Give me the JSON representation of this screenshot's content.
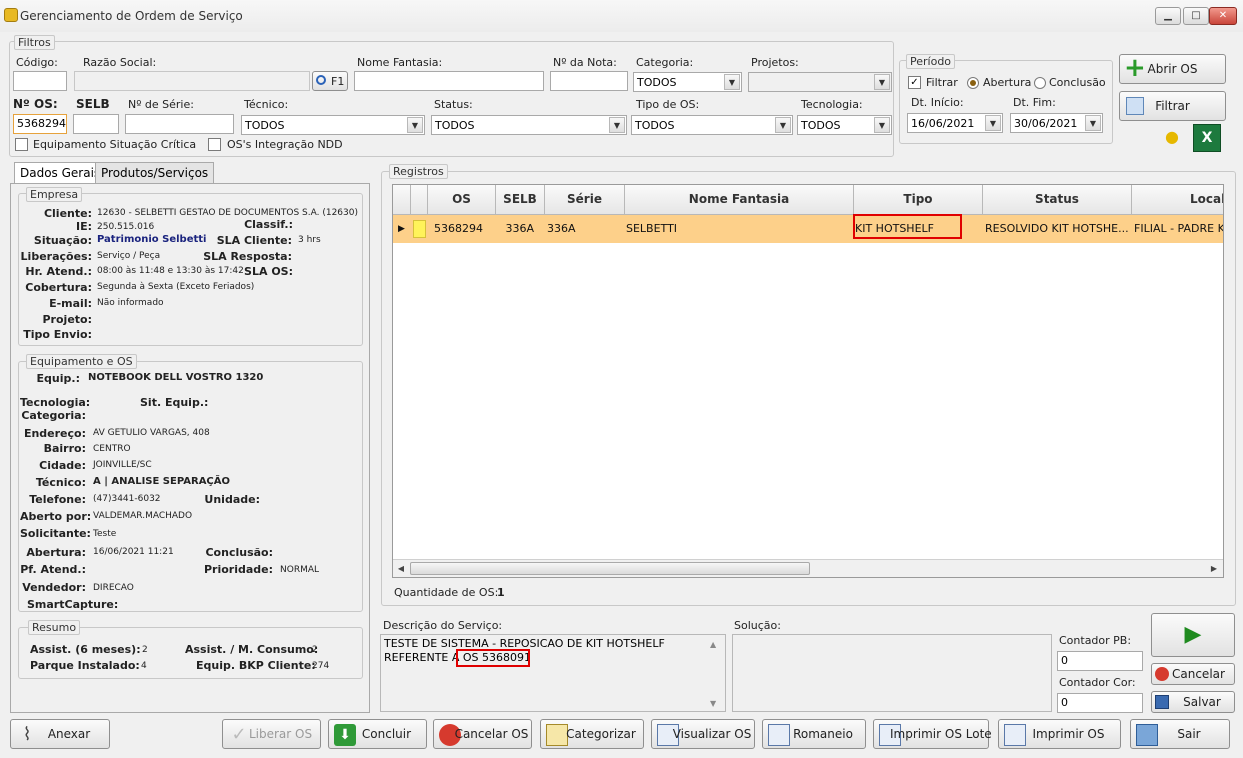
{
  "window": {
    "title": "Gerenciamento de Ordem de Serviço",
    "minimize": "▁",
    "maximize": "□",
    "close": "✕"
  },
  "filters": {
    "legend": "Filtros",
    "codigo_label": "Código:",
    "razao_label": "Razão Social:",
    "f1_label": "F1",
    "nome_fantasia_label": "Nome Fantasia:",
    "nota_label": "Nº da Nota:",
    "categoria_label": "Categoria:",
    "categoria_value": "TODOS",
    "projetos_label": "Projetos:",
    "nos_label": "Nº OS:",
    "nos_value": "5368294",
    "selb_label": "SELB",
    "serie_label": "Nº de Série:",
    "tecnico_label": "Técnico:",
    "tecnico_value": "TODOS",
    "status_label": "Status:",
    "status_value": "TODOS",
    "tipo_label": "Tipo de OS:",
    "tipo_value": "TODOS",
    "tecnologia_label": "Tecnologia:",
    "tecnologia_value": "TODOS",
    "critica_label": "Equipamento Situação Crítica",
    "ndd_label": "OS's Integração NDD"
  },
  "periodo": {
    "legend": "Período",
    "filtrar": "Filtrar",
    "abertura": "Abertura",
    "conclusao": "Conclusão",
    "inicio_label": "Dt. Início:",
    "inicio": "16/06/2021",
    "fim_label": "Dt. Fim:",
    "fim": "30/06/2021"
  },
  "actions": {
    "abrir": "Abrir OS",
    "filtrar": "Filtrar"
  },
  "tabs": {
    "dados": "Dados Gerais",
    "produtos": "Produtos/Serviços"
  },
  "empresa": {
    "legend": "Empresa",
    "cliente_k": "Cliente:",
    "cliente": "12630 - SELBETTI GESTAO DE DOCUMENTOS S.A. (12630)",
    "ie_k": "IE:",
    "ie": "250.515.016",
    "classif_k": "Classif.:",
    "situacao_k": "Situação:",
    "situacao": "Patrimonio Selbetti",
    "sla_cliente_k": "SLA Cliente:",
    "sla_cliente": "3 hrs",
    "liberacoes_k": "Liberações:",
    "liberacoes": "Serviço / Peça",
    "sla_resposta_k": "SLA Resposta:",
    "hr_k": "Hr. Atend.:",
    "hr": "08:00 às 11:48 e 13:30 às 17:42",
    "sla_os_k": "SLA OS:",
    "cobertura_k": "Cobertura:",
    "cobertura": "Segunda à Sexta (Exceto Feriados)",
    "email_k": "E-mail:",
    "email": "Não informado",
    "projeto_k": "Projeto:",
    "envio_k": "Tipo Envio:"
  },
  "equip": {
    "legend": "Equipamento e OS",
    "equip_k": "Equip.:",
    "equip": "NOTEBOOK DELL VOSTRO 1320",
    "tecnologia_k": "Tecnologia:",
    "sit_k": "Sit. Equip.:",
    "categoria_k": "Categoria:",
    "endereco_k": "Endereço:",
    "endereco": "AV GETULIO VARGAS, 408",
    "bairro_k": "Bairro:",
    "bairro": "CENTRO",
    "cidade_k": "Cidade:",
    "cidade": "JOINVILLE/SC",
    "tecnico_k": "Técnico:",
    "tecnico": "A | ANALISE SEPARAÇÃO",
    "telefone_k": "Telefone:",
    "telefone": "(47)3441-6032",
    "unidade_k": "Unidade:",
    "aberto_k": "Aberto por:",
    "aberto": "VALDEMAR.MACHADO",
    "solicitante_k": "Solicitante:",
    "solicitante": "Teste",
    "abertura_k": "Abertura:",
    "abertura": "16/06/2021 11:21",
    "conclusao_k": "Conclusão:",
    "pf_k": "Pf. Atend.:",
    "prioridade_k": "Prioridade:",
    "prioridade": "NORMAL",
    "vendedor_k": "Vendedor:",
    "vendedor": "DIRECAO",
    "smart_k": "SmartCapture:"
  },
  "resumo": {
    "legend": "Resumo",
    "assist_k": "Assist. (6 meses):",
    "assist": "2",
    "consumo_k": "Assist. / M. Consumo:",
    "consumo": "2",
    "parque_k": "Parque Instalado:",
    "parque": "4",
    "bkp_k": "Equip. BKP Cliente:",
    "bkp": "274"
  },
  "registros": {
    "legend": "Registros",
    "columns": [
      "OS",
      "SELB",
      "Série",
      "Nome Fantasia",
      "Tipo",
      "Status",
      "Local"
    ],
    "row": {
      "os": "5368294",
      "selb": "336A",
      "serie": "336A",
      "nome": "SELBETTI",
      "tipo": "KIT HOTSHELF",
      "status": "RESOLVIDO  KIT  HOTSHE...",
      "local": "FILIAL - PADRE K"
    },
    "qtd_label": "Quantidade de OS:",
    "qtd": "1"
  },
  "descricao": {
    "label": "Descrição do Serviço:",
    "line1": "TESTE DE SISTEMA - REPOSICAO DE KIT HOTSHELF",
    "line2_pre": "REFERENTE A",
    "line2_ref": "OS 5368091"
  },
  "solucao": {
    "label": "Solução:"
  },
  "contadores": {
    "pb_label": "Contador PB:",
    "pb": "0",
    "cor_label": "Contador Cor:",
    "cor": "0"
  },
  "side_buttons": {
    "play": "▶",
    "cancelar": "Cancelar",
    "salvar": "Salvar"
  },
  "bottom": {
    "anexar": "Anexar",
    "liberar": "Liberar OS",
    "concluir": "Concluir",
    "cancelar_os": "Cancelar OS",
    "categorizar": "Categorizar",
    "visualizar": "Visualizar OS",
    "romaneio": "Romaneio",
    "imprimir_lote": "Imprimir OS Lote",
    "imprimir": "Imprimir OS",
    "sair": "Sair"
  },
  "colors": {
    "row_highlight": "#fdd08a",
    "selection_box": "#e00000",
    "excel_green": "#1d7a3e",
    "accent_green": "#2a9b2a"
  }
}
